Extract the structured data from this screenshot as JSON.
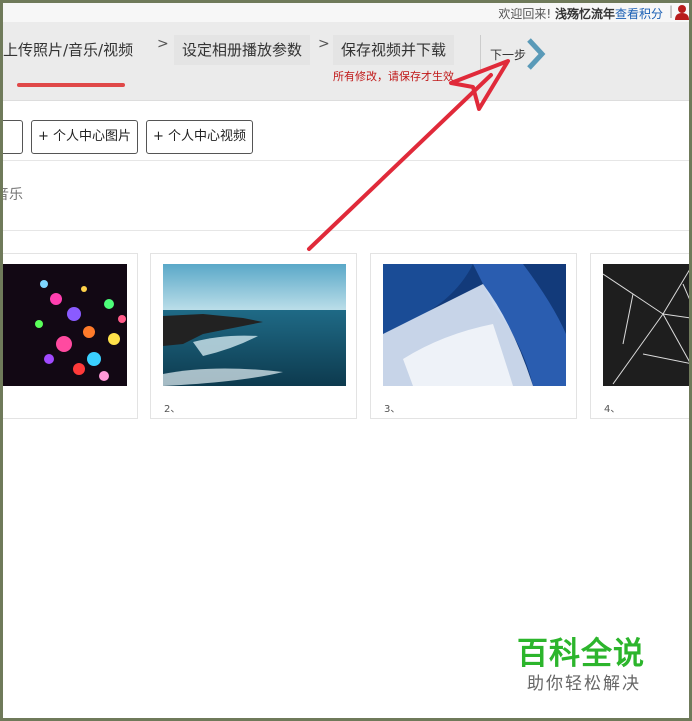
{
  "topbar": {
    "welcome": "欢迎回来!",
    "username": "浅殇忆流年",
    "points_link": "查看积分",
    "separator": "|"
  },
  "steps": {
    "step1": "上传照片/音乐/视频",
    "step2": "设定相册播放参数",
    "step3": "保存视频并下载",
    "separator": ">",
    "hint": "所有修改，请保存才生效",
    "next_label": "下一步"
  },
  "toolbar": {
    "button_add_center_photo": "+ 个人中心图片",
    "button_add_center_video": "+ 个人中心视频"
  },
  "section": {
    "music_label": "音乐"
  },
  "photos": [
    {
      "number": "",
      "desc": "bokeh lights"
    },
    {
      "number": "2、",
      "desc": "rocky coast"
    },
    {
      "number": "3、",
      "desc": "ocean waves"
    },
    {
      "number": "4、",
      "desc": "cracked glass"
    }
  ],
  "watermark": {
    "title": "百科全说",
    "subtitle": "助你轻松解决"
  },
  "colors": {
    "active_underline": "#e04848",
    "hint_red": "#c01818",
    "next_arrow": "#5a9ab8",
    "annotation_arrow": "#e02a3a",
    "watermark_green": "#2cb52c"
  }
}
